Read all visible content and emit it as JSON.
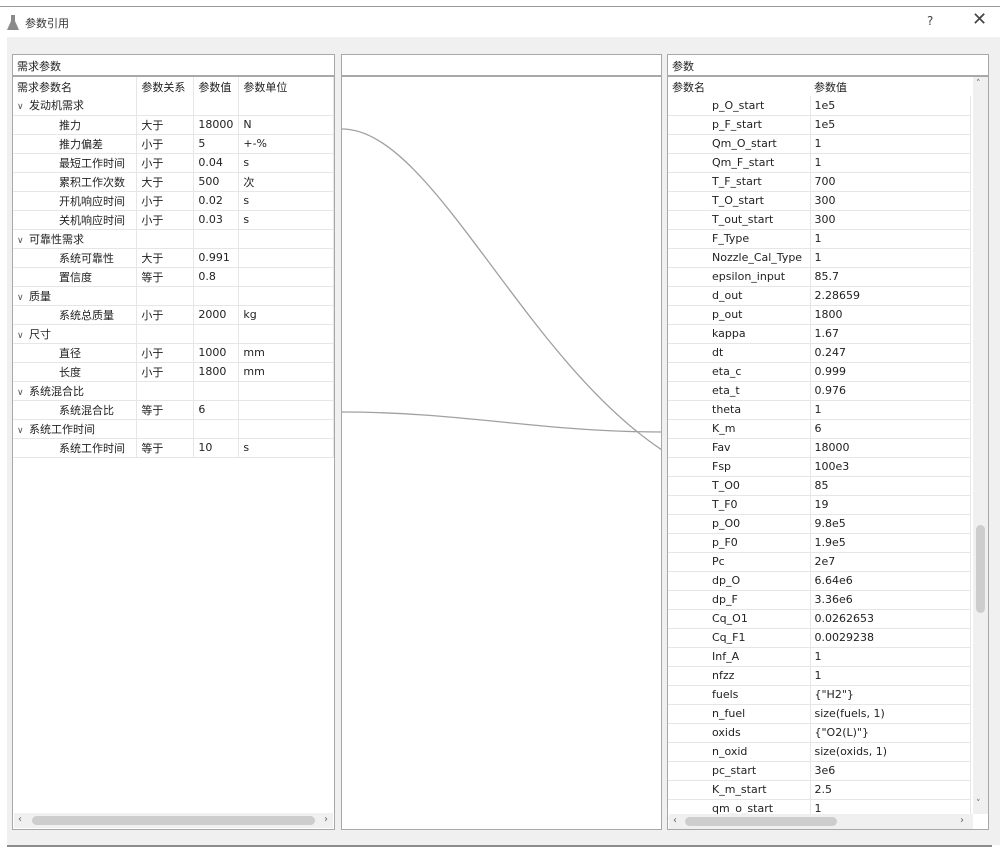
{
  "window": {
    "title": "参数引用",
    "icon": "flask-icon",
    "help_label": "?",
    "close_label": "✕"
  },
  "left_panel": {
    "title": "需求参数",
    "columns": [
      "需求参数名",
      "参数关系",
      "参数值",
      "参数单位"
    ],
    "groups": [
      {
        "name": "发动机需求",
        "rows": [
          {
            "name": "推力",
            "relation": "大于",
            "value": "18000",
            "unit": "N"
          },
          {
            "name": "推力偏差",
            "relation": "小于",
            "value": "5",
            "unit": "+-%"
          },
          {
            "name": "最短工作时间",
            "relation": "小于",
            "value": "0.04",
            "unit": "s"
          },
          {
            "name": "累积工作次数",
            "relation": "大于",
            "value": "500",
            "unit": "次"
          },
          {
            "name": "开机响应时间",
            "relation": "小于",
            "value": "0.02",
            "unit": "s"
          },
          {
            "name": "关机响应时间",
            "relation": "小于",
            "value": "0.03",
            "unit": "s"
          }
        ]
      },
      {
        "name": "可靠性需求",
        "rows": [
          {
            "name": "系统可靠性",
            "relation": "大于",
            "value": "0.991",
            "unit": ""
          },
          {
            "name": "置信度",
            "relation": "等于",
            "value": "0.8",
            "unit": ""
          }
        ]
      },
      {
        "name": "质量",
        "rows": [
          {
            "name": "系统总质量",
            "relation": "小于",
            "value": "2000",
            "unit": "kg"
          }
        ]
      },
      {
        "name": "尺寸",
        "rows": [
          {
            "name": "直径",
            "relation": "小于",
            "value": "1000",
            "unit": "mm"
          },
          {
            "name": "长度",
            "relation": "小于",
            "value": "1800",
            "unit": "mm"
          }
        ]
      },
      {
        "name": "系统混合比",
        "rows": [
          {
            "name": "系统混合比",
            "relation": "等于",
            "value": "6",
            "unit": ""
          }
        ]
      },
      {
        "name": "系统工作时间",
        "rows": [
          {
            "name": "系统工作时间",
            "relation": "等于",
            "value": "10",
            "unit": "s"
          }
        ]
      }
    ],
    "scroll_left": "‹",
    "scroll_right": "›"
  },
  "middle_panel": {
    "title": "",
    "links": [
      {
        "from": "推力",
        "to": "Fav"
      },
      {
        "from": "系统混合比",
        "to": "K_m"
      }
    ]
  },
  "right_panel": {
    "title": "参数",
    "columns": [
      "参数名",
      "参数值"
    ],
    "rows": [
      {
        "name": "p_O_start",
        "value": "1e5"
      },
      {
        "name": "p_F_start",
        "value": "1e5"
      },
      {
        "name": "Qm_O_start",
        "value": "1"
      },
      {
        "name": "Qm_F_start",
        "value": "1"
      },
      {
        "name": "T_F_start",
        "value": "700"
      },
      {
        "name": "T_O_start",
        "value": "300"
      },
      {
        "name": "T_out_start",
        "value": "300"
      },
      {
        "name": "F_Type",
        "value": "1"
      },
      {
        "name": "Nozzle_Cal_Type",
        "value": "1"
      },
      {
        "name": "epsilon_input",
        "value": "85.7"
      },
      {
        "name": "d_out",
        "value": "2.28659"
      },
      {
        "name": "p_out",
        "value": "1800"
      },
      {
        "name": "kappa",
        "value": "1.67"
      },
      {
        "name": "dt",
        "value": "0.247"
      },
      {
        "name": "eta_c",
        "value": "0.999"
      },
      {
        "name": "eta_t",
        "value": "0.976"
      },
      {
        "name": "theta",
        "value": "1"
      },
      {
        "name": "K_m",
        "value": "6"
      },
      {
        "name": "Fav",
        "value": "18000"
      },
      {
        "name": "Fsp",
        "value": "100e3"
      },
      {
        "name": "T_O0",
        "value": "85"
      },
      {
        "name": "T_F0",
        "value": "19"
      },
      {
        "name": "p_O0",
        "value": "9.8e5"
      },
      {
        "name": "p_F0",
        "value": "1.9e5"
      },
      {
        "name": "Pc",
        "value": "2e7"
      },
      {
        "name": "dp_O",
        "value": "6.64e6"
      },
      {
        "name": "dp_F",
        "value": "3.36e6"
      },
      {
        "name": "Cq_O1",
        "value": "0.0262653"
      },
      {
        "name": "Cq_F1",
        "value": "0.0029238"
      },
      {
        "name": "Inf_A",
        "value": "1"
      },
      {
        "name": "nfzz",
        "value": "1"
      },
      {
        "name": "fuels",
        "value": "{\"H2\"}"
      },
      {
        "name": "n_fuel",
        "value": "size(fuels, 1)"
      },
      {
        "name": "oxids",
        "value": "{\"O2(L)\"}"
      },
      {
        "name": "n_oxid",
        "value": "size(oxids, 1)"
      },
      {
        "name": "pc_start",
        "value": "3e6"
      },
      {
        "name": "K_m_start",
        "value": "2.5"
      },
      {
        "name": "qm_o_start",
        "value": "1"
      }
    ],
    "scroll_up": "˄",
    "scroll_down": "˅",
    "scroll_left": "‹",
    "scroll_right": "›"
  }
}
